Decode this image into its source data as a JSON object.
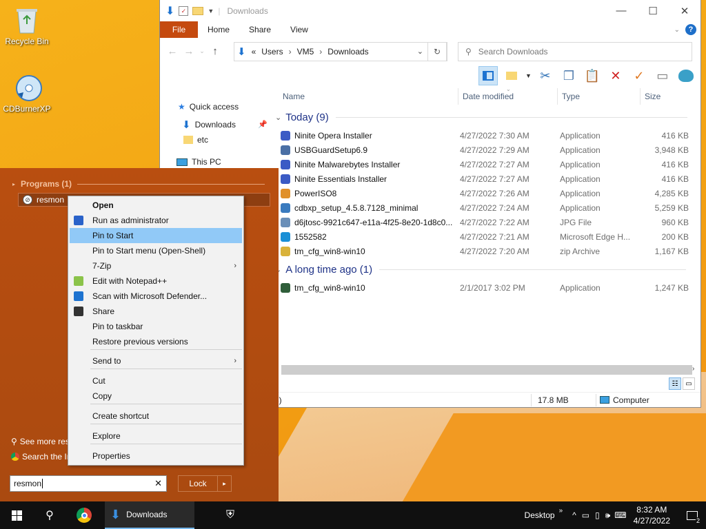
{
  "desktop": {
    "icons": [
      {
        "label": "Recycle Bin",
        "icon": "recycle-bin-icon"
      },
      {
        "label": "CDBurnerXP",
        "icon": "cdburnerxp-icon"
      }
    ]
  },
  "explorer": {
    "title": "Downloads",
    "ribbon_tabs": [
      "File",
      "Home",
      "Share",
      "View"
    ],
    "address": {
      "sep": "«",
      "crumbs": [
        "Users",
        "VM5",
        "Downloads"
      ]
    },
    "search_placeholder": "Search Downloads",
    "nav": {
      "quick_access": "Quick access",
      "downloads": "Downloads",
      "etc": "etc",
      "this_pc": "This PC"
    },
    "columns": {
      "name": "Name",
      "date": "Date modified",
      "type": "Type",
      "size": "Size"
    },
    "groups": [
      {
        "label": "Today (9)",
        "files": [
          {
            "name": "Ninite Opera Installer",
            "date": "4/27/2022 7:30 AM",
            "type": "Application",
            "size": "416 KB",
            "icon": "ninite-icon",
            "color": "#3b5bc5"
          },
          {
            "name": "USBGuardSetup6.9",
            "date": "4/27/2022 7:29 AM",
            "type": "Application",
            "size": "3,948 KB",
            "icon": "usbguard-icon",
            "color": "#4a6fa5"
          },
          {
            "name": "Ninite Malwarebytes Installer",
            "date": "4/27/2022 7:27 AM",
            "type": "Application",
            "size": "416 KB",
            "icon": "ninite-icon",
            "color": "#3b5bc5"
          },
          {
            "name": "Ninite Essentials Installer",
            "date": "4/27/2022 7:27 AM",
            "type": "Application",
            "size": "416 KB",
            "icon": "ninite-icon",
            "color": "#3b5bc5"
          },
          {
            "name": "PowerISO8",
            "date": "4/27/2022 7:26 AM",
            "type": "Application",
            "size": "4,285 KB",
            "icon": "poweriso-icon",
            "color": "#e0902a"
          },
          {
            "name": "cdbxp_setup_4.5.8.7128_minimal",
            "date": "4/27/2022 7:24 AM",
            "type": "Application",
            "size": "5,259 KB",
            "icon": "cdbxp-setup-icon",
            "color": "#3a7bbf"
          },
          {
            "name": "d6jtosc-9921c647-e11a-4f25-8e20-1d8c0...",
            "date": "4/27/2022 7:22 AM",
            "type": "JPG File",
            "size": "960 KB",
            "icon": "image-file-icon",
            "color": "#6a8fb8"
          },
          {
            "name": "1552582",
            "date": "4/27/2022 7:21 AM",
            "type": "Microsoft Edge H...",
            "size": "200 KB",
            "icon": "edge-icon",
            "color": "#1a8fd6"
          },
          {
            "name": "tm_cfg_win8-win10",
            "date": "4/27/2022 7:20 AM",
            "type": "zip Archive",
            "size": "1,167 KB",
            "icon": "zip-icon",
            "color": "#d9b23a"
          }
        ]
      },
      {
        "label": "A long time ago (1)",
        "files": [
          {
            "name": "tm_cfg_win8-win10",
            "date": "2/1/2017 3:02 PM",
            "type": "Application",
            "size": "1,247 KB",
            "icon": "app-icon",
            "color": "#2f5e3a"
          }
        ]
      }
    ],
    "status": {
      "left": "3)",
      "size": "17.8 MB",
      "computer": "Computer"
    }
  },
  "start_menu": {
    "programs_header": "Programs (1)",
    "program": "resmon",
    "see_more": "See more res",
    "search_internet": "Search the In",
    "search_value": "resmon",
    "lock_label": "Lock"
  },
  "context_menu": {
    "items": [
      {
        "label": "Open",
        "bold": true
      },
      {
        "label": "Run as administrator",
        "icon": "shield-icon"
      },
      {
        "label": "Pin to Start",
        "highlight": true
      },
      {
        "label": "Pin to Start menu (Open-Shell)"
      },
      {
        "label": "7-Zip",
        "sub": true
      },
      {
        "label": "Edit with Notepad++",
        "icon": "notepadpp-icon"
      },
      {
        "label": "Scan with Microsoft Defender...",
        "icon": "defender-icon"
      },
      {
        "label": "Share",
        "icon": "share-icon"
      },
      {
        "label": "Pin to taskbar"
      },
      {
        "label": "Restore previous versions"
      },
      {
        "label": "Send to",
        "sub": true
      },
      {
        "label": "Cut"
      },
      {
        "label": "Copy"
      },
      {
        "label": "Create shortcut"
      },
      {
        "label": "Explore"
      },
      {
        "label": "Properties"
      }
    ]
  },
  "taskbar": {
    "downloads_label": "Downloads",
    "desktop_label": "Desktop",
    "time": "8:32 AM",
    "date": "4/27/2022",
    "notif_count": "2"
  }
}
